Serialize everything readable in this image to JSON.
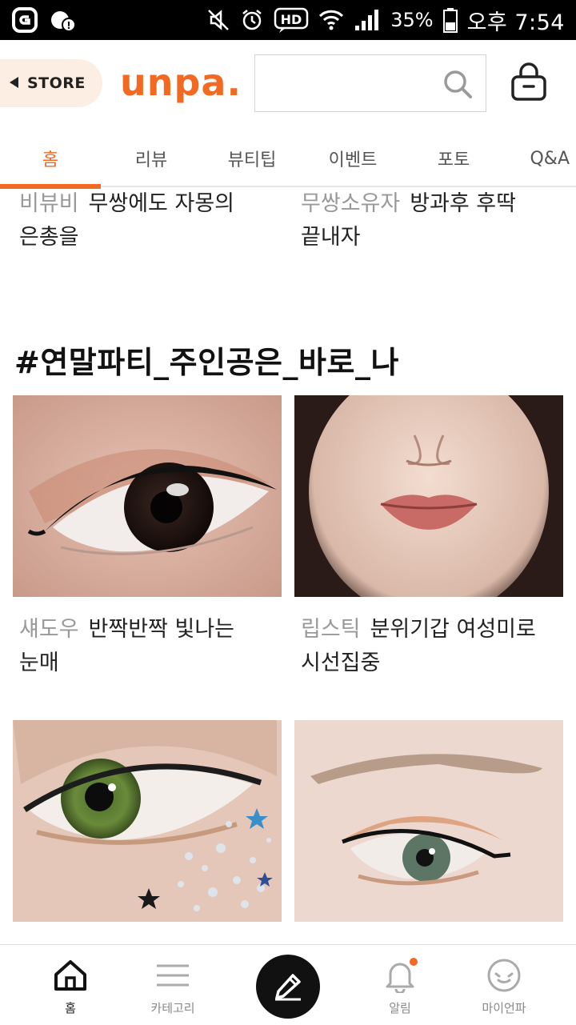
{
  "status_bar": {
    "battery_percent": "35%",
    "time": "오후 7:54",
    "hd_label": "HD"
  },
  "header": {
    "store_label": "STORE",
    "logo_text": "unpa.",
    "search_placeholder": "",
    "brand_color": "#f26a21"
  },
  "tabs": [
    {
      "label": "홈",
      "active": true
    },
    {
      "label": "리뷰"
    },
    {
      "label": "뷰티팁"
    },
    {
      "label": "이벤트"
    },
    {
      "label": "포토"
    },
    {
      "label": "Q&A"
    }
  ],
  "top_cards": [
    {
      "category": "비뷰비",
      "title_line1": "무쌍에도 자몽의",
      "title_line2": "은총을"
    },
    {
      "category": "무쌍소유자",
      "title_line1": "방과후 후딱",
      "title_line2": "끝내자"
    }
  ],
  "section": {
    "title": "#연말파티_주인공은_바로_나"
  },
  "cards": [
    {
      "category": "섀도우",
      "title_line1": "반짝반짝 빛나는",
      "title_line2": "눈매",
      "image": "eye-makeup-brown-eyeliner"
    },
    {
      "category": "립스틱",
      "title_line1": "분위기갑 여성미로",
      "title_line2": "시선집중",
      "image": "lips-coral-lipstick"
    },
    {
      "category": "",
      "title_line1": "",
      "title_line2": "",
      "image": "green-eye-glitter-stars"
    },
    {
      "category": "",
      "title_line1": "",
      "title_line2": "",
      "image": "orange-shadow-eyeliner"
    }
  ],
  "bottom_nav": [
    {
      "label": "홈",
      "icon": "home-icon",
      "active": true
    },
    {
      "label": "카테고리",
      "icon": "menu-icon"
    },
    {
      "label": "",
      "icon": "pencil-icon"
    },
    {
      "label": "알림",
      "icon": "bell-icon",
      "badge": true
    },
    {
      "label": "마이언파",
      "icon": "face-icon"
    }
  ]
}
